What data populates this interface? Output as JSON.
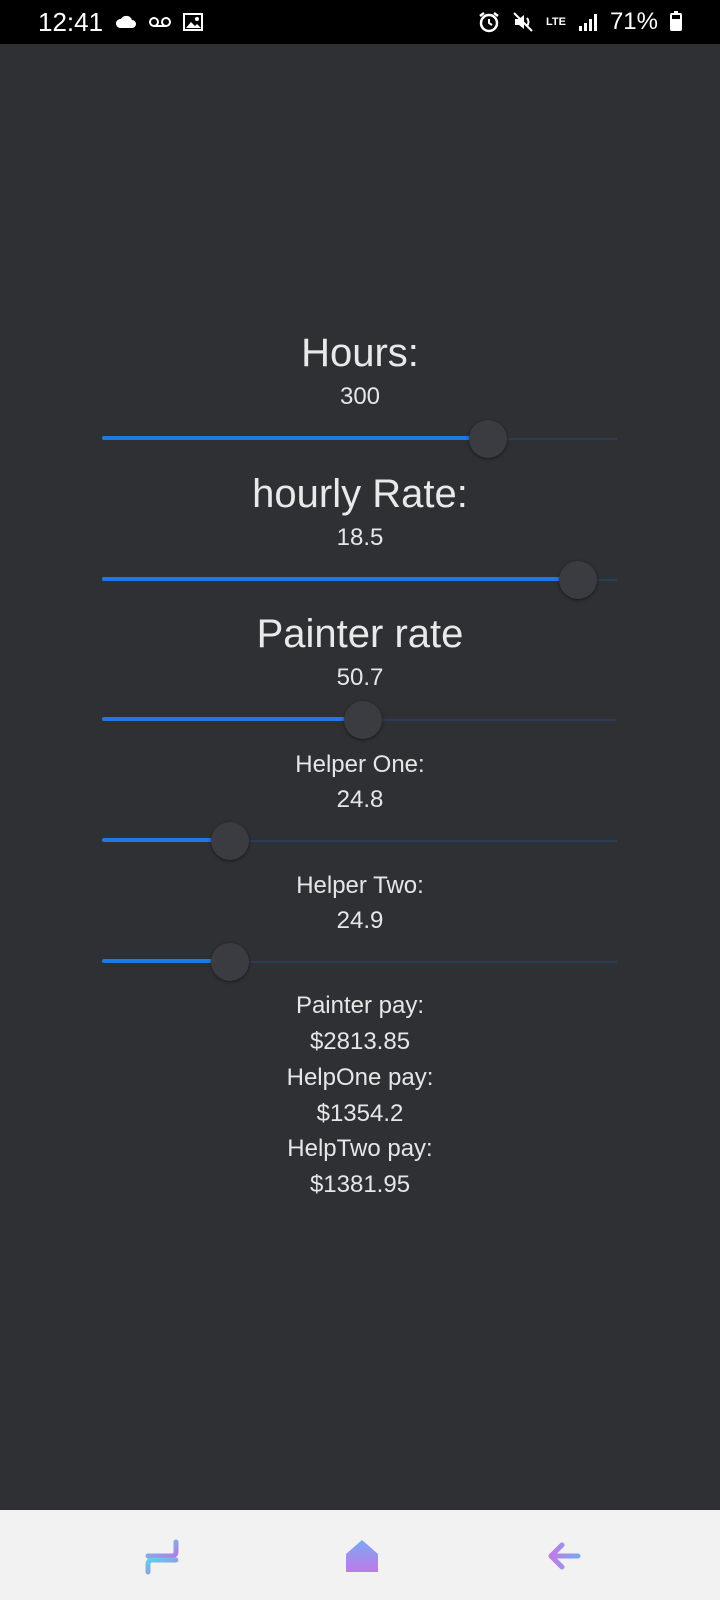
{
  "status_bar": {
    "time": "12:41",
    "battery_text": "71%",
    "icons": [
      "cloud-icon",
      "voicemail-icon",
      "image-icon",
      "alarm-icon",
      "mute-icon",
      "lte-icon",
      "signal-icon",
      "battery-icon"
    ],
    "lte_label": "LTE"
  },
  "main": {
    "hours": {
      "label": "Hours:",
      "value": "300",
      "slider_level": 0.75
    },
    "hourly_rate": {
      "label": "hourly Rate:",
      "value": "18.5",
      "slider_level": 0.925
    },
    "painter_rate": {
      "label": "Painter rate",
      "value": "50.7",
      "slider_level": 0.507
    },
    "helper_one": {
      "label": "Helper One:",
      "value": "24.8",
      "slider_level": 0.248
    },
    "helper_two": {
      "label": "Helper Two:",
      "value": "24.9",
      "slider_level": 0.249
    },
    "results": {
      "painter_pay_label": "Painter pay:",
      "painter_pay_value": "$2813.85",
      "helpone_pay_label": "HelpOne pay:",
      "helpone_pay_value": "$1354.2",
      "helptwo_pay_label": "HelpTwo pay:",
      "helptwo_pay_value": "$1381.95"
    }
  },
  "nav_bar": {
    "icons": [
      "recents-icon",
      "home-icon",
      "back-icon"
    ]
  },
  "colors": {
    "background": "#2e3034",
    "slider_active": "#1e78e6",
    "slider_inactive": "#2b3c57",
    "thumb": "#3a3c41",
    "nav_background": "#f2f2f2"
  }
}
